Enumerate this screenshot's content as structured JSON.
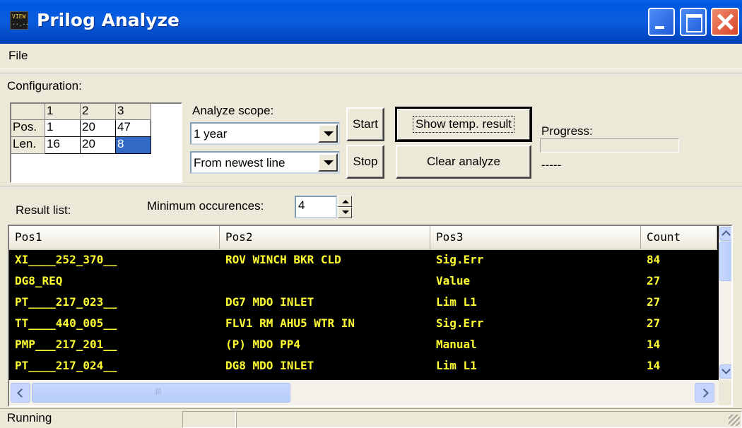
{
  "window": {
    "title": "Prilog Analyze",
    "icon_lines": [
      "VIEW",
      "··.··"
    ]
  },
  "menu": {
    "file": "File"
  },
  "config": {
    "label": "Configuration:",
    "columns": [
      "1",
      "2",
      "3"
    ],
    "rows": [
      {
        "label": "Pos.",
        "values": [
          "1",
          "20",
          "47"
        ]
      },
      {
        "label": "Len.",
        "values": [
          "16",
          "20",
          "8"
        ]
      }
    ],
    "selected_cell": "Len. column 3"
  },
  "scope": {
    "label": "Analyze scope:",
    "period": "1 year",
    "direction": "From newest line"
  },
  "buttons": {
    "start": "Start",
    "stop": "Stop",
    "show_temp": "Show temp. result",
    "clear": "Clear analyze"
  },
  "progress": {
    "label": "Progress:",
    "value_text": "-----",
    "fraction": 0
  },
  "results": {
    "label": "Result list:",
    "min_occ_label": "Minimum occurences:",
    "min_occ_value": "4",
    "columns": [
      "Pos1",
      "Pos2",
      "Pos3",
      "Count"
    ],
    "rows": [
      [
        "XI____252_370__",
        "ROV WINCH BKR CLD",
        "Sig.Err",
        "84"
      ],
      [
        "DG8_REQ",
        "",
        "Value",
        "27"
      ],
      [
        "PT____217_023__",
        "DG7 MDO INLET",
        "Lim L1",
        "27"
      ],
      [
        "TT____440_005__",
        "FLV1 RM AHU5 WTR IN",
        "Sig.Err",
        "27"
      ],
      [
        "PMP___217_201__",
        "(P) MDO PP4",
        "Manual",
        "14"
      ],
      [
        "PT____217_024__",
        "DG8 MDO INLET",
        "Lim L1",
        "14"
      ]
    ],
    "text_color": "#FFFF33",
    "background": "#000000"
  },
  "status": {
    "text": "Running"
  },
  "colors": {
    "titlebar": "#0058E2",
    "face": "#ECE9D8",
    "selection": "#316AC5"
  }
}
